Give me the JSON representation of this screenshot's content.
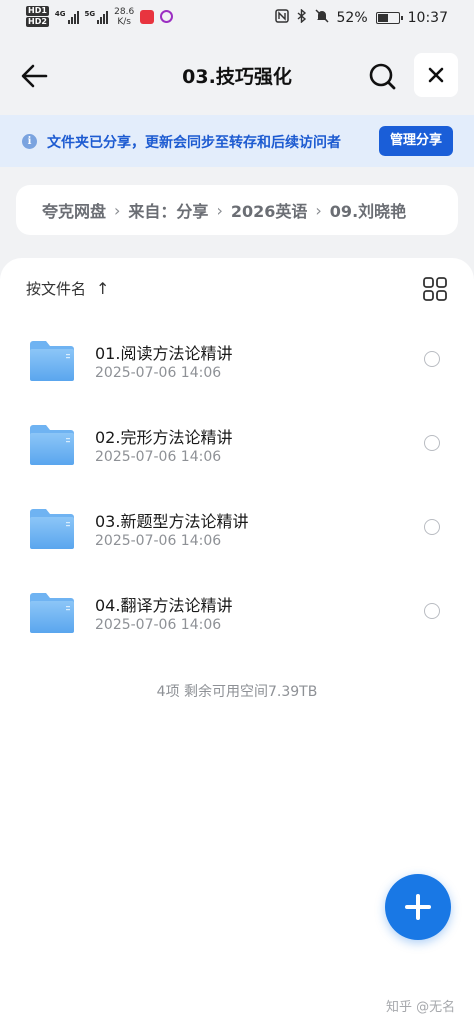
{
  "status_bar": {
    "hd1": "HD1",
    "hd2": "HD2",
    "net1": "4G",
    "net2": "5G",
    "speed_value": "28.6",
    "speed_unit": "K/s",
    "battery": "52%",
    "battery_level": 52,
    "time": "10:37"
  },
  "header": {
    "title": "03.技巧强化"
  },
  "notice": {
    "text": "文件夹已分享，更新会同步至转存和后续访问者",
    "button": "管理分享"
  },
  "breadcrumb": [
    "夸克网盘",
    "来自：分享",
    "2026英语",
    "09.刘晓艳"
  ],
  "breadcrumb_separator": "›",
  "sort": {
    "label": "按文件名",
    "arrow": "↑"
  },
  "files": [
    {
      "name": "01.阅读方法论精讲",
      "date": "2025-07-06 14:06"
    },
    {
      "name": "02.完形方法论精讲",
      "date": "2025-07-06 14:06"
    },
    {
      "name": "03.新题型方法论精讲",
      "date": "2025-07-06 14:06"
    },
    {
      "name": "04.翻译方法论精讲",
      "date": "2025-07-06 14:06"
    }
  ],
  "summary": "4项 剩余可用空间7.39TB",
  "watermark": "知乎 @无名",
  "colors": {
    "accent": "#1a5ed8",
    "fab": "#1978e5",
    "notice_bg": "#e3edfb",
    "folder": "#62aef0"
  },
  "icons": {
    "back": "arrow-left-icon",
    "search": "search-icon",
    "close": "close-icon",
    "info": "info-icon",
    "grid": "grid-view-icon",
    "folder": "folder-icon",
    "add": "plus-icon"
  }
}
